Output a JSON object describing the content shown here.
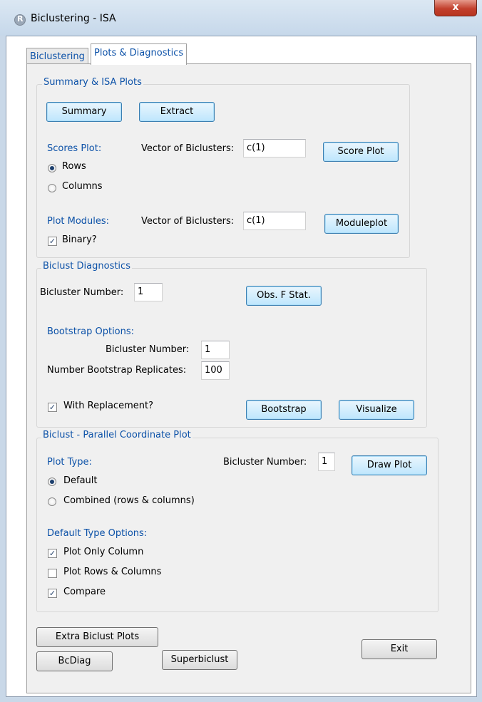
{
  "window": {
    "title": "Biclustering - ISA",
    "close_label": "x"
  },
  "tabs": [
    {
      "label": "Biclustering",
      "active": false
    },
    {
      "label": "Plots & Diagnostics",
      "active": true
    }
  ],
  "summary_group": {
    "legend": "Summary & ISA Plots",
    "summary_button": "Summary",
    "extract_button": "Extract",
    "scores_plot_label": "Scores Plot:",
    "vector_label": "Vector of Biclusters:",
    "scores_vector_value": "c(1)",
    "score_plot_button": "Score Plot",
    "rows_label": "Rows",
    "columns_label": "Columns",
    "plot_modules_label": "Plot Modules:",
    "modules_vector_value": "c(1)",
    "moduleplot_button": "Moduleplot",
    "binary_label": "Binary?"
  },
  "diagnostics_group": {
    "legend": "Biclust Diagnostics",
    "bicluster_number_label": "Bicluster Number:",
    "bicluster_number_value": "1",
    "obs_f_button": "Obs. F Stat.",
    "bootstrap_options_label": "Bootstrap Options:",
    "bootstrap_bicluster_label": "Bicluster Number:",
    "bootstrap_bicluster_value": "1",
    "replicates_label": "Number Bootstrap Replicates:",
    "replicates_value": "100",
    "with_replacement_label": "With Replacement?",
    "bootstrap_button": "Bootstrap",
    "visualize_button": "Visualize"
  },
  "parallel_group": {
    "legend": "Biclust - Parallel Coordinate Plot",
    "plot_type_label": "Plot Type:",
    "bicluster_number_label": "Bicluster Number:",
    "bicluster_number_value": "1",
    "draw_plot_button": "Draw Plot",
    "default_label": "Default",
    "combined_label": "Combined (rows & columns)",
    "default_type_options_label": "Default Type Options:",
    "plot_only_column_label": "Plot Only Column",
    "plot_rows_columns_label": "Plot Rows & Columns",
    "compare_label": "Compare"
  },
  "bottom": {
    "extra_button": "Extra Biclust Plots",
    "bcdiag_button": "BcDiag",
    "superbiclust_button": "Superbiclust",
    "exit_button": "Exit"
  },
  "state": {
    "scores_plot_selection": "Rows",
    "plot_type_selection": "Default",
    "binary_checked": true,
    "with_replacement_checked": true,
    "plot_only_column_checked": true,
    "plot_rows_columns_checked": false,
    "compare_checked": true
  }
}
